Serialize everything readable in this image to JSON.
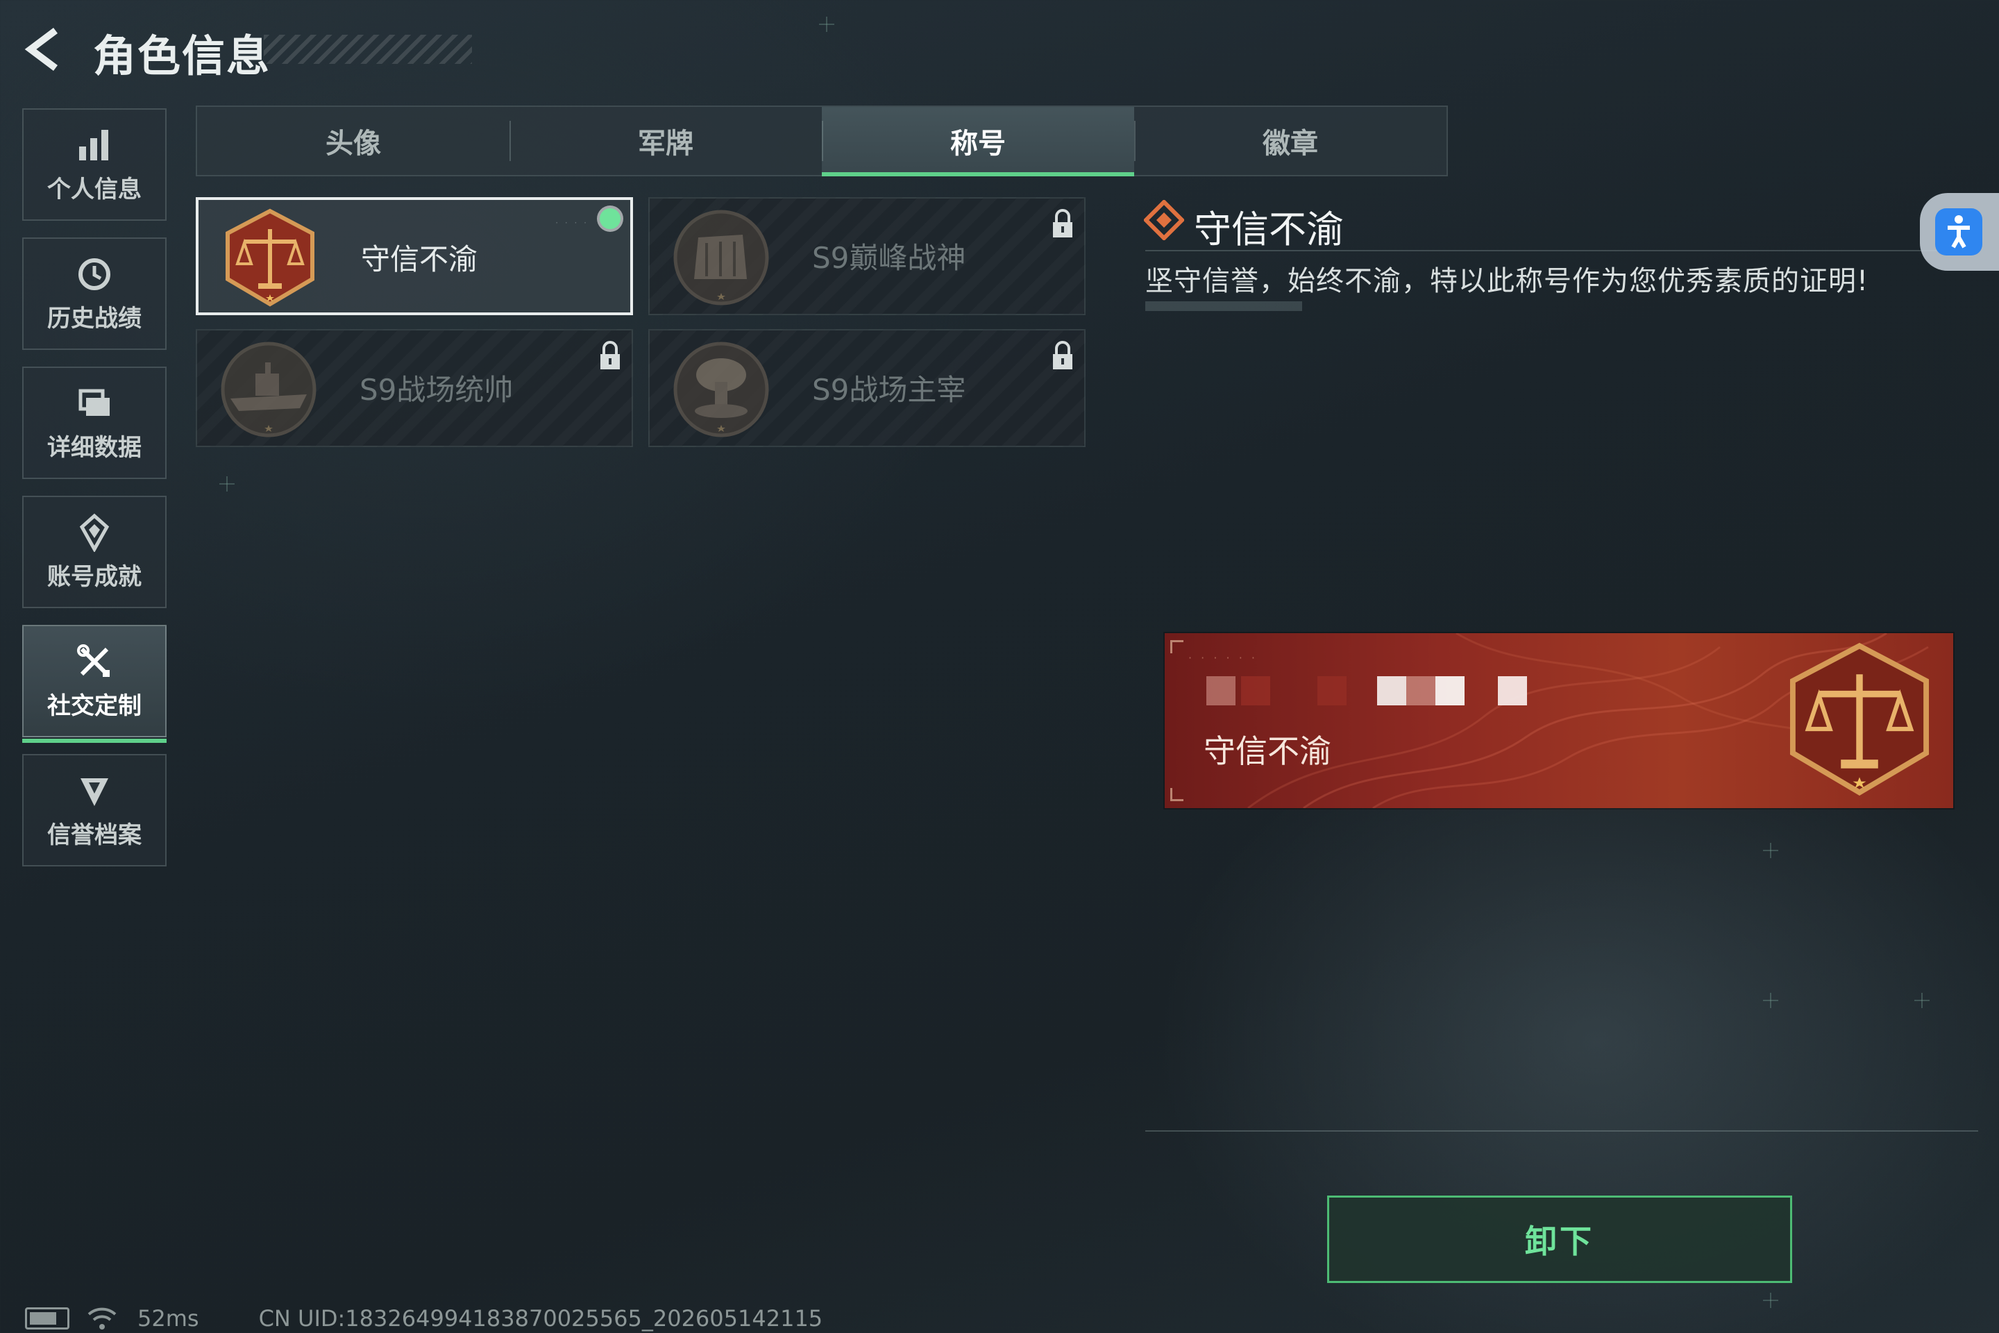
{
  "header": {
    "title": "角色信息"
  },
  "sidebar": {
    "items": [
      {
        "label": "个人信息",
        "icon": "bar-chart-icon"
      },
      {
        "label": "历史战绩",
        "icon": "history-icon"
      },
      {
        "label": "详细数据",
        "icon": "folder-icon"
      },
      {
        "label": "账号成就",
        "icon": "achievement-icon"
      },
      {
        "label": "社交定制",
        "icon": "tools-icon",
        "active": true
      },
      {
        "label": "信誉档案",
        "icon": "credit-icon"
      }
    ]
  },
  "tabs": [
    {
      "label": "头像"
    },
    {
      "label": "军牌"
    },
    {
      "label": "称号",
      "active": true
    },
    {
      "label": "徽章"
    }
  ],
  "titles": [
    {
      "name": "守信不渝",
      "state": "equipped"
    },
    {
      "name": "S9巅峰战神",
      "state": "locked"
    },
    {
      "name": "S9战场统帅",
      "state": "locked"
    },
    {
      "name": "S9战场主宰",
      "state": "locked"
    }
  ],
  "detail": {
    "title": "守信不渝",
    "description": "坚守信誉，始终不渝，特以此称号作为您优秀素质的证明!"
  },
  "banner": {
    "name": "守信不渝"
  },
  "action": {
    "unequip_label": "卸下"
  },
  "status_bar": {
    "ping": "52ms",
    "uid": "CN UID:183264994183870025565_202605142115"
  },
  "colors": {
    "accent_green": "#5fd08a",
    "banner_red": "#8e2a22",
    "lock_gray": "#6d7779"
  }
}
